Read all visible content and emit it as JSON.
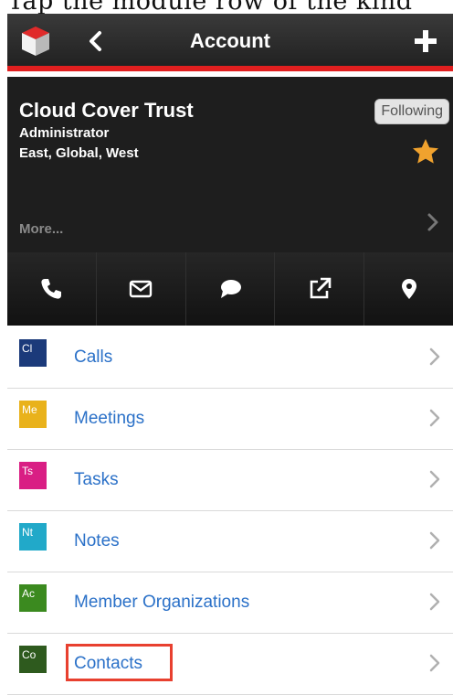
{
  "caption": "Tap the module row of the kind",
  "navbar": {
    "title": "Account"
  },
  "account": {
    "name": "Cloud Cover Trust",
    "role": "Administrator",
    "teams": "East, Global, West",
    "following_label": "Following",
    "more_label": "More..."
  },
  "actions": [
    {
      "icon": "phone-icon"
    },
    {
      "icon": "mail-icon"
    },
    {
      "icon": "chat-icon"
    },
    {
      "icon": "external-link-icon"
    },
    {
      "icon": "map-pin-icon"
    }
  ],
  "modules": [
    {
      "badge": "Cl",
      "label": "Calls",
      "color": "#1b3a7a"
    },
    {
      "badge": "Me",
      "label": "Meetings",
      "color": "#e9b21b"
    },
    {
      "badge": "Ts",
      "label": "Tasks",
      "color": "#d91e84"
    },
    {
      "badge": "Nt",
      "label": "Notes",
      "color": "#21a9c9"
    },
    {
      "badge": "Ac",
      "label": "Member Organizations",
      "color": "#3b8a1f"
    },
    {
      "badge": "Co",
      "label": "Contacts",
      "color": "#2e5a1e"
    }
  ],
  "colors": {
    "accent_red": "#e11f1f",
    "link_blue": "#2b71c8",
    "star_orange": "#f0a22e",
    "highlight": "#e8402f"
  }
}
